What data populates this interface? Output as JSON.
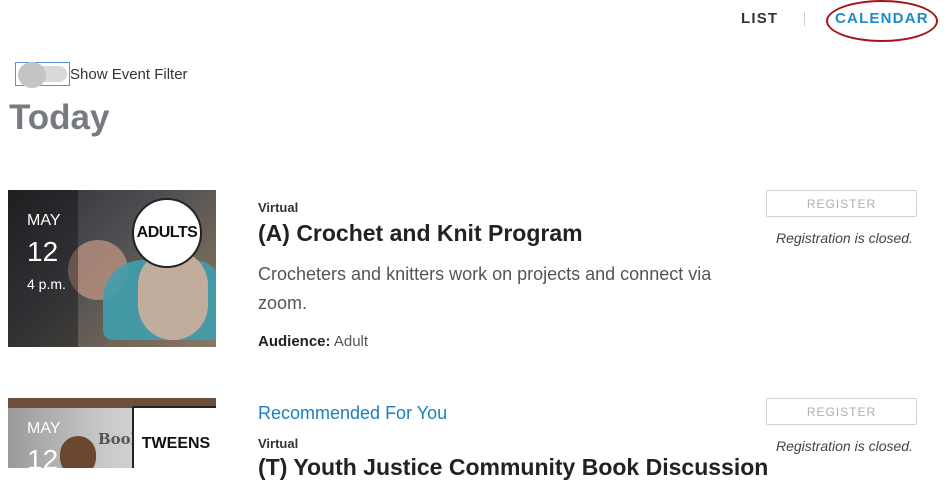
{
  "view_nav": {
    "list_label": "LIST",
    "calendar_label": "CALENDAR"
  },
  "filter": {
    "toggle_state": "off",
    "label": "Show Event Filter"
  },
  "page_title": "Today",
  "events": [
    {
      "recommended": "",
      "month": "MAY",
      "day": "12",
      "time": "4 p.m.",
      "badge": "ADULTS",
      "location": "Virtual",
      "title": "(A) Crochet and Knit Program",
      "description": "Crocheters and knitters work on projects and connect via zoom.",
      "audience_label": "Audience:",
      "audience_value": "Adult",
      "register_label": "REGISTER",
      "registration_status": "Registration is closed."
    },
    {
      "recommended": "Recommended For You",
      "month": "MAY",
      "day": "12",
      "time": "",
      "badge": "TWEENS",
      "image_text": "Book CHA",
      "location": "Virtual",
      "title": "(T) Youth Justice Community Book Discussion",
      "register_label": "REGISTER",
      "registration_status": "Registration is closed."
    }
  ],
  "colors": {
    "accent": "#1b8bc9",
    "title_gray": "#777b80",
    "annotation_circle": "#a31616"
  }
}
